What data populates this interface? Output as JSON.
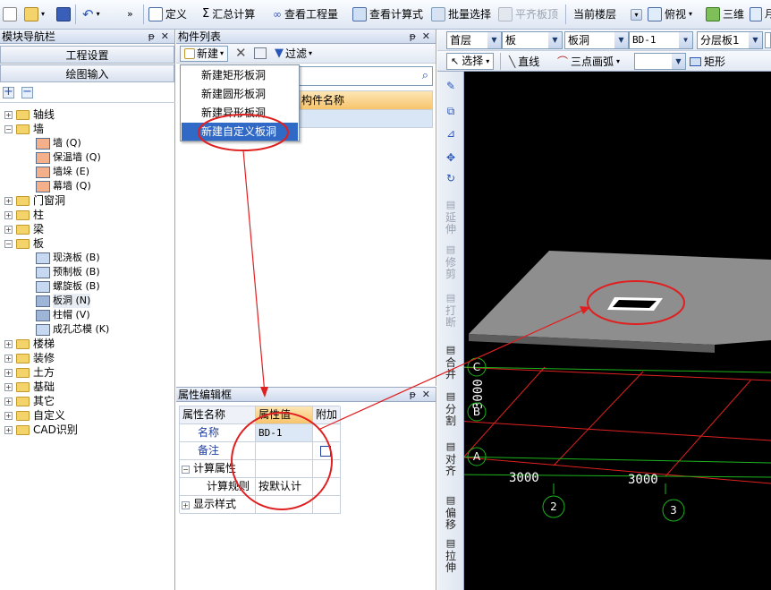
{
  "toolbar": {
    "define": "定义",
    "sum_calc": "汇总计算",
    "view_quantity": "查看工程量",
    "view_formula": "查看计算式",
    "batch_select": "批量选择",
    "flush_slab_top": "平齐板顶",
    "current_floor": "当前楼层",
    "top_view": "俯视",
    "three_d": "三维",
    "more": "»"
  },
  "nav_panel": {
    "title": "模块导航栏",
    "btn_project_settings": "工程设置",
    "btn_drawing_input": "绘图输入",
    "tree": [
      {
        "label": "轴线",
        "type": "folder",
        "expanded": false
      },
      {
        "label": "墙",
        "type": "folder",
        "expanded": true
      },
      {
        "label": "墙 (Q)",
        "type": "leaf"
      },
      {
        "label": "保温墙 (Q)",
        "type": "leaf"
      },
      {
        "label": "墙垛 (E)",
        "type": "leaf"
      },
      {
        "label": "幕墙 (Q)",
        "type": "leaf"
      },
      {
        "label": "门窗洞",
        "type": "folder",
        "expanded": false
      },
      {
        "label": "柱",
        "type": "folder",
        "expanded": false
      },
      {
        "label": "梁",
        "type": "folder",
        "expanded": false
      },
      {
        "label": "板",
        "type": "folder",
        "expanded": true
      },
      {
        "label": "现浇板 (B)",
        "type": "leaf"
      },
      {
        "label": "预制板 (B)",
        "type": "leaf"
      },
      {
        "label": "螺旋板 (B)",
        "type": "leaf"
      },
      {
        "label": "板洞 (N)",
        "type": "leaf"
      },
      {
        "label": "柱帽 (V)",
        "type": "leaf"
      },
      {
        "label": "成孔芯模 (K)",
        "type": "leaf"
      },
      {
        "label": "楼梯",
        "type": "folder",
        "expanded": false
      },
      {
        "label": "装修",
        "type": "folder",
        "expanded": false
      },
      {
        "label": "土方",
        "type": "folder",
        "expanded": false
      },
      {
        "label": "基础",
        "type": "folder",
        "expanded": false
      },
      {
        "label": "其它",
        "type": "folder",
        "expanded": false
      },
      {
        "label": "自定义",
        "type": "folder",
        "expanded": false
      },
      {
        "label": "CAD识别",
        "type": "folder",
        "expanded": false
      }
    ]
  },
  "component_list": {
    "title": "构件列表",
    "new_label": "新建",
    "filter_label": "过滤",
    "column_name": "构件名称",
    "new_menu": [
      "新建矩形板洞",
      "新建圆形板洞",
      "新建异形板洞",
      "新建自定义板洞"
    ]
  },
  "property_editor": {
    "title": "属性编辑框",
    "col_name": "属性名称",
    "col_value": "属性值",
    "col_extra": "附加",
    "rows": [
      {
        "name": "名称",
        "value": "BD-1"
      },
      {
        "name": "备注",
        "value": ""
      },
      {
        "name": "计算属性",
        "value": ""
      },
      {
        "name": "计算规则",
        "value": "按默认计"
      },
      {
        "name": "显示样式",
        "value": ""
      }
    ]
  },
  "view_toolbar": {
    "floor": "首层",
    "category": "板",
    "element": "板洞",
    "item": "BD-1",
    "layer": "分层板1",
    "select": "选择",
    "line": "直线",
    "arc3": "三点画弧",
    "rect": "矩形"
  },
  "vertical_tools": [
    "延伸",
    "修剪",
    "打断",
    "合并",
    "分割",
    "对齐",
    "偏移",
    "拉伸"
  ],
  "viewport": {
    "dim_bottom_1": "3000",
    "dim_bottom_2": "3000",
    "dim_side": "3000",
    "axis_labels": [
      "C",
      "B",
      "A",
      "2",
      "3"
    ]
  }
}
